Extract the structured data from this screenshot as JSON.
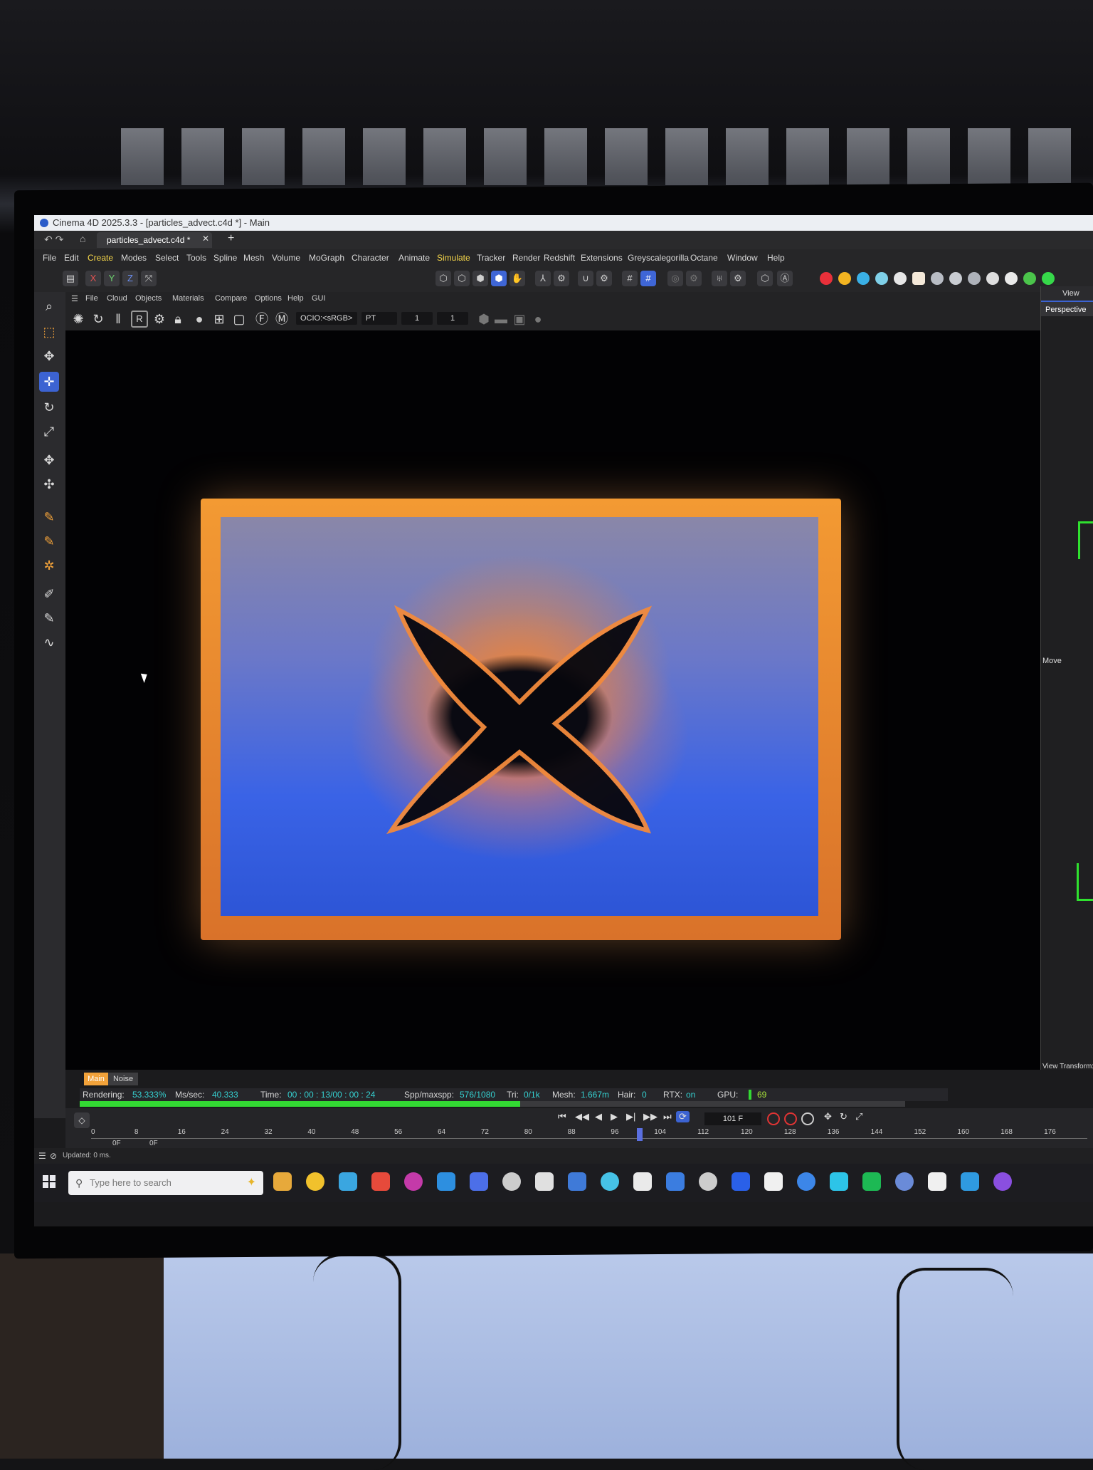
{
  "window": {
    "title": "Cinema 4D 2025.3.3 - [particles_advect.c4d *] - Main",
    "tab_label": "particles_advect.c4d *",
    "tab_close": "✕",
    "tab_add": "+"
  },
  "menu": {
    "items": [
      "File",
      "Edit",
      "Create",
      "Modes",
      "Select",
      "Tools",
      "Spline",
      "Mesh",
      "Volume",
      "MoGraph",
      "Character",
      "Animate",
      "Simulate",
      "Tracker",
      "Render",
      "Redshift",
      "Extensions",
      "Greyscalegorilla",
      "Octane",
      "Window",
      "Help"
    ]
  },
  "axis_buttons": [
    "X",
    "Y",
    "Z"
  ],
  "viewport_menu": {
    "items": [
      "File",
      "Cloud",
      "Objects",
      "Materials",
      "Compare",
      "Options",
      "Help",
      "GUI"
    ]
  },
  "viewport_toolbar": {
    "render_mode_label": "R",
    "ocio_label": "OCIO:<sRGB>",
    "pt_label": "PT",
    "field_a": "1",
    "field_b": "1"
  },
  "right_panel": {
    "view_label": "View",
    "perspective_label": "Perspective",
    "move_label": "Move",
    "view_transform_label": "View Transform: S"
  },
  "render_status": {
    "layer_tab_main": "Main",
    "layer_tab_noise": "Noise",
    "rendering_label": "Rendering:",
    "rendering_value": "53.333%",
    "ms_label": "Ms/sec:",
    "ms_value": "40.333",
    "time_label": "Time:",
    "time_value": "00 : 00 : 13/00 : 00 : 24",
    "spp_label": "Spp/maxspp:",
    "spp_value": "576/1080",
    "tri_label": "Tri:",
    "tri_value": "0/1k",
    "mesh_label": "Mesh:",
    "mesh_value": "1.667m",
    "hair_label": "Hair:",
    "hair_value": "0",
    "rtx_label": "RTX:",
    "rtx_value": "on",
    "gpu_label": "GPU:",
    "gpu_value": "69",
    "progress": 0.53333
  },
  "timeline": {
    "ticks": [
      "0",
      "8",
      "16",
      "24",
      "32",
      "40",
      "48",
      "56",
      "64",
      "72",
      "80",
      "88",
      "96",
      "104",
      "112",
      "120",
      "128",
      "136",
      "144",
      "152",
      "160",
      "168",
      "176"
    ],
    "current_frame_marker": "101",
    "frame_field": "101 F",
    "start_label": "0F",
    "end_label": "0F"
  },
  "app_status": {
    "text": "Updated: 0 ms."
  },
  "taskbar": {
    "search_placeholder": "Type here to search",
    "app_colors": [
      "#e7a93b",
      "#f1c12c",
      "#3aa6e0",
      "#e64a3b",
      "#c43aa9",
      "#2d8fe0",
      "#4c6fe8",
      "#cccccc",
      "#e0e0e0",
      "#3f7ad8",
      "#46c2e6",
      "#eaeaea",
      "#3b7de0",
      "#cccccc",
      "#2a60e8",
      "#f0f0f0",
      "#3c86e8",
      "#2dc4e8",
      "#1db954",
      "#6a8bd8",
      "#f0f0f0",
      "#2f9ae0",
      "#8a4fe0"
    ]
  },
  "colors": {
    "accent_blue": "#3c63d2",
    "menu_highlight": "#f5d64a",
    "progress_green": "#33d933",
    "status_value_cyan": "#35d0d0",
    "frame_orange": "#f39a33"
  }
}
